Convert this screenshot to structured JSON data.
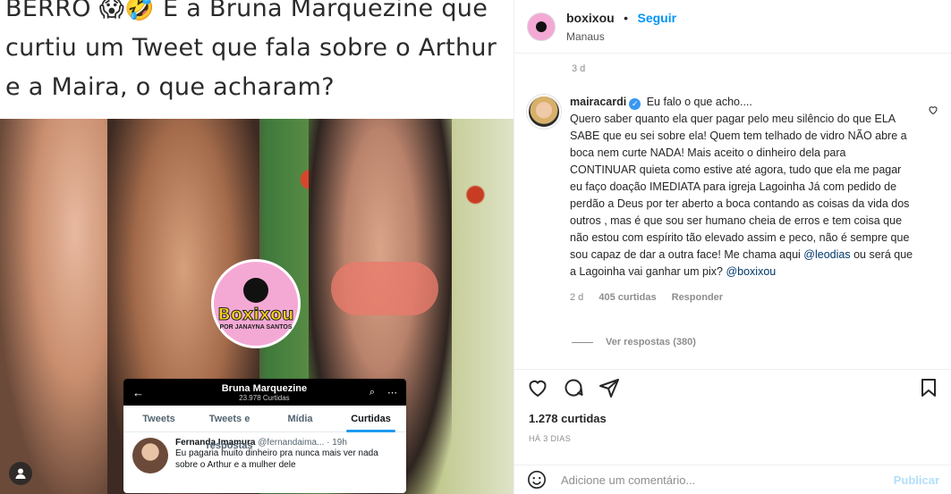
{
  "post_image": {
    "headline": "BERRO 😱🤣 E a Bruna Marquezine que curtiu um Tweet que fala sobre o Arthur e a Maira, o que acharam?",
    "logo": {
      "brand": "Boxixou",
      "sub": "POR JANAYNA SANTOS"
    },
    "twitter_card": {
      "back_icon": "arrow-left-icon",
      "profile_name": "Bruna Marquezine",
      "likes_count": "23.978 Curtidas",
      "tabs": [
        "Tweets",
        "Tweets e respostas",
        "Mídia",
        "Curtidas"
      ],
      "active_tab": "Curtidas",
      "tweet": {
        "author": "Fernanda Imamura",
        "handle": "@fernandaima...",
        "time": "· 19h",
        "text": "Eu pagaria muito dinheiro pra nunca mais ver nada sobre o Arthur e a mulher dele"
      }
    }
  },
  "header": {
    "username": "boxixou",
    "separator": "•",
    "follow_label": "Seguir",
    "location": "Manaus"
  },
  "caption_age": "3 d",
  "comment": {
    "username": "mairacardi",
    "text_intro": "Eu falo o que acho....",
    "text_body": "Quero saber quanto ela quer pagar pelo meu silêncio do que ELA SABE que eu sei sobre ela! Quem tem telhado de vidro NÃO abre a boca nem curte NADA! Mais aceito o dinheiro dela para CONTINUAR quieta como estive até agora, tudo que ela me pagar eu faço doação IMEDIATA para igreja Lagoinha Já com pedido de perdão a Deus por ter aberto a boca contando as coisas da vida dos outros , mas é que sou ser humano cheia de erros e tem coisa que não estou com espírito tão elevado assim e peco, não é sempre que sou capaz de dar a outra face! Me chama aqui",
    "mention_1": "@leodias",
    "text_tail": "ou será que a Lagoinha vai ganhar um pix?",
    "mention_2": "@boxixou",
    "age": "2 d",
    "likes": "405 curtidas",
    "reply_label": "Responder",
    "view_replies": "Ver respostas (380)"
  },
  "actions": {
    "likes": "1.278 curtidas",
    "posted": "HÁ 3 DIAS"
  },
  "add_comment": {
    "placeholder": "Adicione um comentário...",
    "publish_label": "Publicar"
  }
}
